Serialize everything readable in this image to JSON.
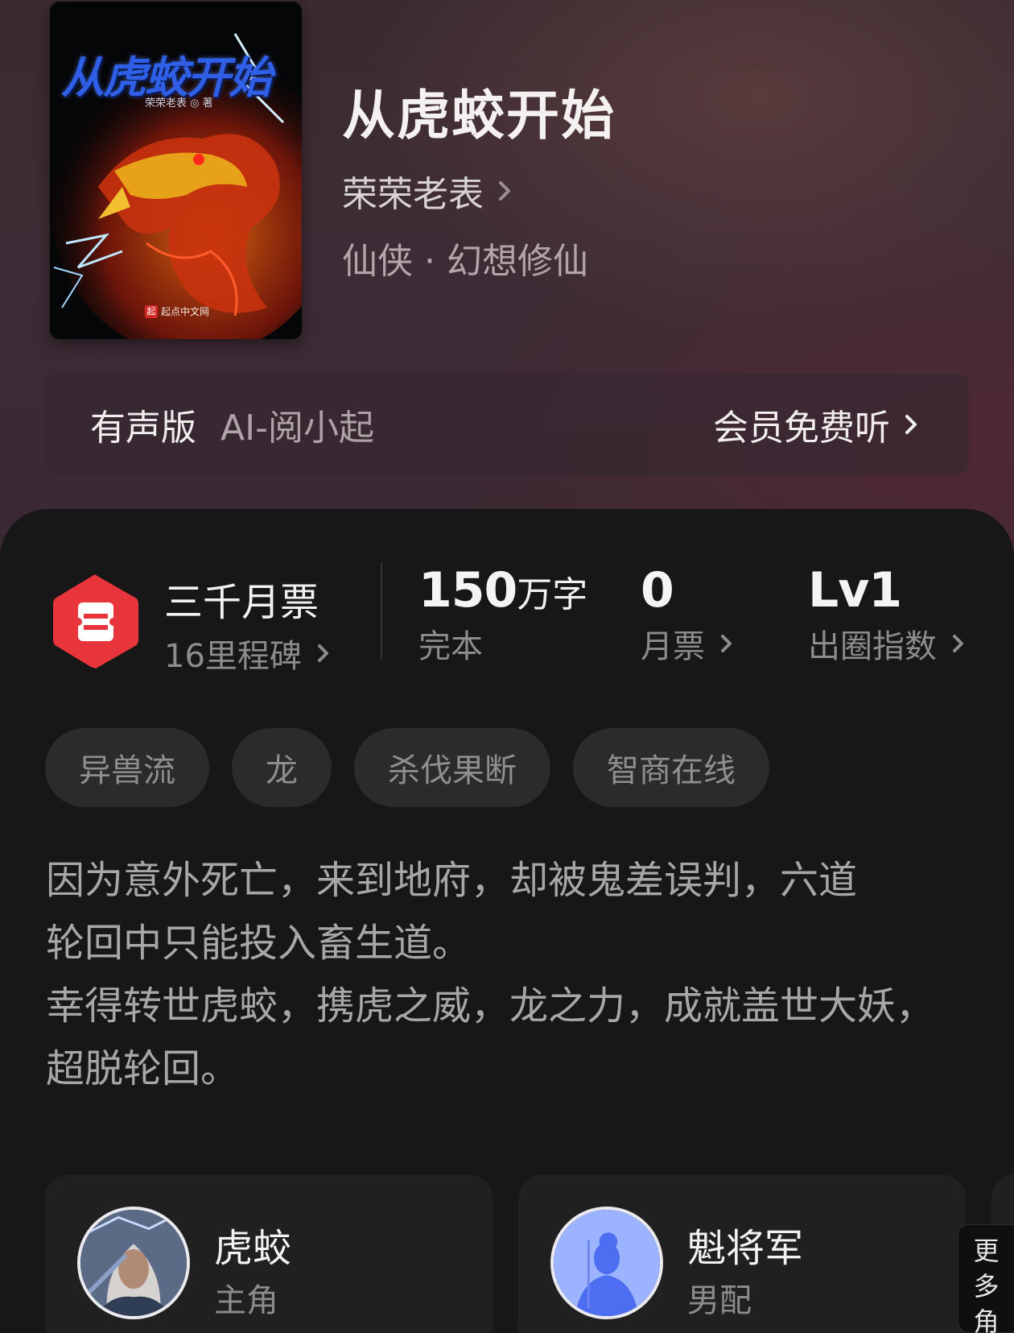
{
  "book": {
    "cover": {
      "title_art": "从虎蛟开始",
      "author_art": "荣荣老表 ◎ 著",
      "publisher_art": "起点中文网",
      "publisher_logo": "起"
    },
    "title": "从虎蛟开始",
    "author": "荣荣老表",
    "genre": "仙侠 · 幻想修仙"
  },
  "audio": {
    "label": "有声版",
    "voice": "AI-阅小起",
    "action": "会员免费听"
  },
  "stats": {
    "ticket_rank": "三千月票",
    "milestones": "16里程碑",
    "word_count_number": "150",
    "word_count_unit": "万字",
    "status": "完本",
    "monthly_votes_value": "0",
    "monthly_votes_label": "月票",
    "popularity_value": "Lv1",
    "popularity_label": "出圈指数"
  },
  "tags": [
    "异兽流",
    "龙",
    "杀伐果断",
    "智商在线"
  ],
  "synopsis": [
    "因为意外死亡，来到地府，却被鬼差误判，六道",
    "轮回中只能投入畜生道。",
    "幸得转世虎蛟，携虎之威，龙之力，成就盖世大妖，",
    "超脱轮回。"
  ],
  "characters": [
    {
      "name": "虎蛟",
      "role": "主角"
    },
    {
      "name": "魁将军",
      "role": "男配"
    }
  ],
  "more_characters": [
    "更",
    "多",
    "角"
  ],
  "colors": {
    "ticket_icon": "#e8353b",
    "background": "#171717",
    "tag_bg": "#2b2b2b"
  }
}
